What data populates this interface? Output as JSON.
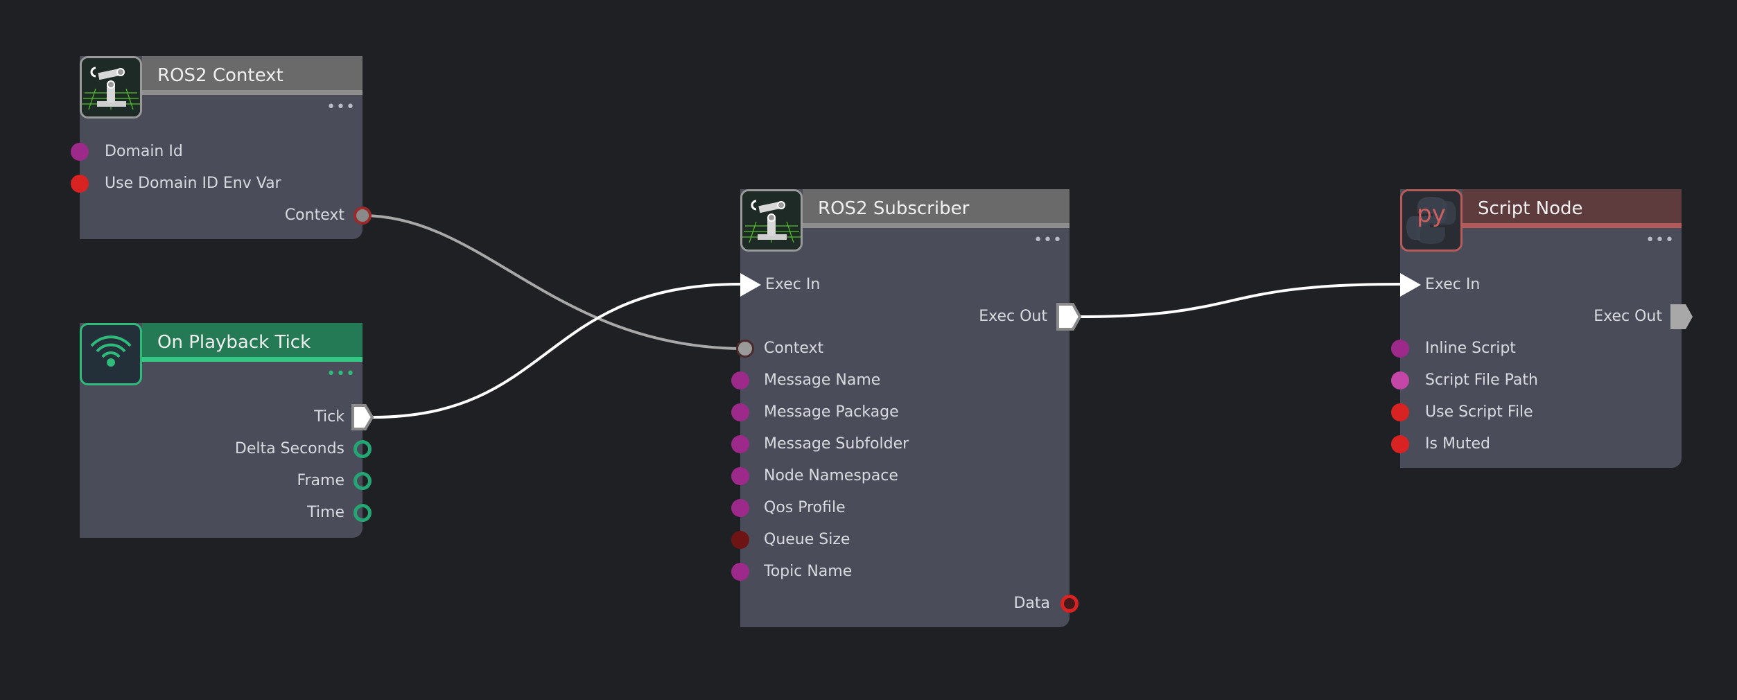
{
  "nodes": {
    "ros2_context": {
      "title": "ROS2 Context",
      "inputs": [
        "Domain Id",
        "Use Domain ID Env Var"
      ],
      "outputs": [
        "Context"
      ]
    },
    "on_playback_tick": {
      "title": "On Playback Tick",
      "outputs": [
        "Tick",
        "Delta Seconds",
        "Frame",
        "Time"
      ]
    },
    "ros2_subscriber": {
      "title": "ROS2 Subscriber",
      "exec_in": "Exec In",
      "exec_out": "Exec Out",
      "inputs": [
        "Context",
        "Message Name",
        "Message Package",
        "Message Subfolder",
        "Node Namespace",
        "Qos Profile",
        "Queue Size",
        "Topic Name"
      ],
      "outputs": [
        "Data"
      ]
    },
    "script_node": {
      "title": "Script Node",
      "icon_text": "py",
      "exec_in": "Exec In",
      "exec_out": "Exec Out",
      "inputs": [
        "Inline Script",
        "Script File Path",
        "Use Script File",
        "Is Muted"
      ]
    }
  },
  "colors": {
    "background": "#1f2023",
    "node_body": "#4a4d59",
    "header_grey": "#6a6a6a",
    "header_green": "#247a54",
    "header_red": "#5e3b3d",
    "pin_magenta": "#9d2a8b",
    "pin_red": "#d92222",
    "pin_green": "#23a574",
    "wire_exec": "#ffffff",
    "wire_context": "#a8a8a8"
  },
  "icons": {
    "ros2_context": "robot-arm-icon",
    "on_playback_tick": "broadcast-signal-icon",
    "ros2_subscriber": "robot-arm-icon",
    "script_node": "python-icon"
  }
}
